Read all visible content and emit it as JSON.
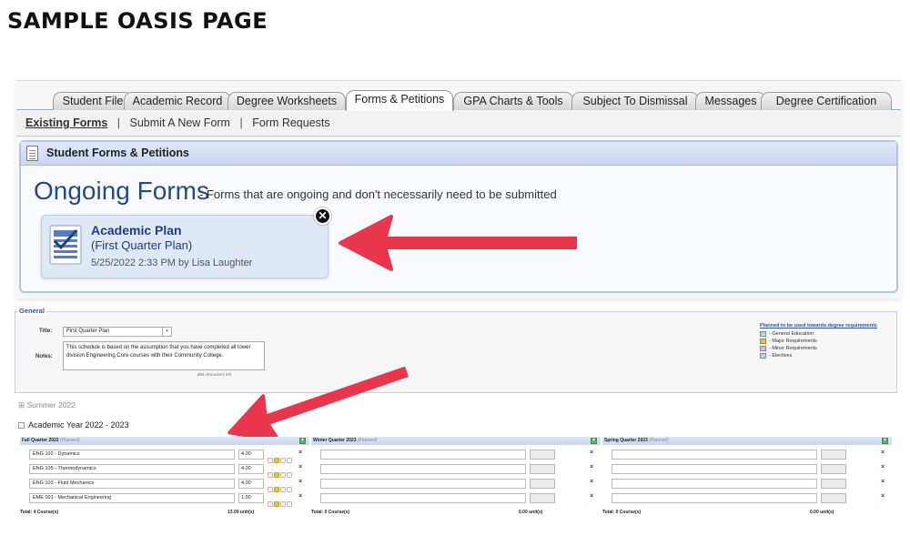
{
  "page": {
    "heading": "SAMPLE OASIS PAGE"
  },
  "colors": {
    "arrow": "#e8374d",
    "header_blue": "#c8d6f2",
    "title_blue": "#244a8c",
    "link_blue": "#1c3d8a"
  },
  "oasis": {
    "tabs": [
      {
        "label": "Student File"
      },
      {
        "label": "Academic Record"
      },
      {
        "label": "Degree Worksheets"
      },
      {
        "label": "Forms & Petitions"
      },
      {
        "label": "GPA Charts & Tools"
      },
      {
        "label": "Subject To Dismissal"
      },
      {
        "label": "Messages"
      },
      {
        "label": "Degree Certification"
      }
    ],
    "active_tab": "Forms & Petitions",
    "subnav": {
      "existing": "Existing Forms",
      "submit": "Submit A New Form",
      "requests": "Form Requests",
      "separator": "|"
    },
    "panel_title": "Student Forms & Petitions",
    "ongoing_title": "Ongoing Forms",
    "ongoing_subtitle": "- Forms that are ongoing and don't necessarily need to be submitted",
    "card": {
      "title": "Academic Plan",
      "subtitle": "(First Quarter Plan)",
      "meta": "5/25/2022 2:33 PM by Lisa Laughter",
      "close_glyph": "✕",
      "icon": "document-checklist-icon"
    }
  },
  "plan": {
    "general_legend": "General",
    "title_label": "Title:",
    "title_value": "First Quarter Plan",
    "notes_label": "Notes:",
    "notes_value": "This schedule is based on the assumption that you have completed all lower division Engineering Core courses with their Community College.",
    "chars_left": "856 characters left",
    "legend_title": "Planned to be used towards degree requirements",
    "legend": [
      {
        "label": "- General Education",
        "color": "#b6e0b6"
      },
      {
        "label": "- Major Requirements",
        "color": "#f1c232"
      },
      {
        "label": "- Minor Requirements",
        "color": "#d9b3e6"
      },
      {
        "label": "- Electives",
        "color": "#bcd4f0"
      }
    ],
    "summer_label": "Summer 2022",
    "expand_glyph": "⊞",
    "year_title": "Academic Year 2022 - 2023",
    "quarters": [
      {
        "name": "Fall Quarter 2022",
        "status": "(Planned)",
        "courses": [
          {
            "course": "ENG 102 - Dynamics",
            "units": "4.00"
          },
          {
            "course": "ENG 105 - Thermodynamics",
            "units": "4.00"
          },
          {
            "course": "ENG 103 - Fluid Mechanics",
            "units": "4.00"
          },
          {
            "course": "EME 001 - Mechanical Engineering",
            "units": "1.00"
          }
        ],
        "total": "Total: 4 Course(s)",
        "units_total": "13.00 unit(s)"
      },
      {
        "name": "Winter Quarter 2023",
        "status": "(Planned)",
        "courses": [
          {
            "course": "",
            "units": ""
          },
          {
            "course": "",
            "units": ""
          },
          {
            "course": "",
            "units": ""
          },
          {
            "course": "",
            "units": ""
          }
        ],
        "total": "Total: 0 Course(s)",
        "units_total": "0.00 unit(s)"
      },
      {
        "name": "Spring Quarter 2023",
        "status": "(Planned)",
        "courses": [
          {
            "course": "",
            "units": ""
          },
          {
            "course": "",
            "units": ""
          },
          {
            "course": "",
            "units": ""
          },
          {
            "course": "",
            "units": ""
          }
        ],
        "total": "Total: 0 Course(s)",
        "units_total": "0.00 unit(s)"
      }
    ],
    "add_glyph": "+",
    "delete_glyph": "×"
  }
}
